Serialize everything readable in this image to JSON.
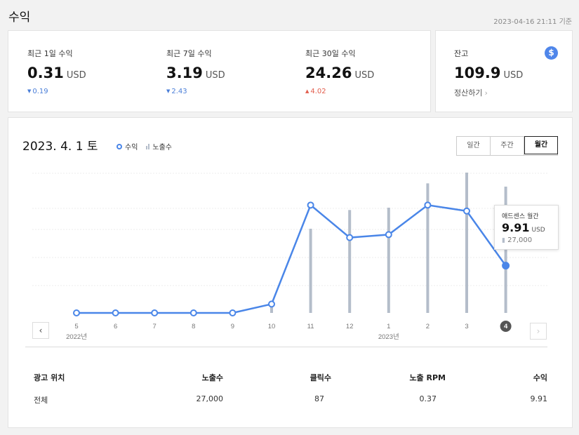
{
  "page": {
    "title": "수익",
    "updated": "2023-04-16 21:11 기준"
  },
  "summary": [
    {
      "label": "최근 1일 수익",
      "value": "0.31",
      "unit": "USD",
      "delta": "0.19",
      "direction": "down"
    },
    {
      "label": "최근 7일 수익",
      "value": "3.19",
      "unit": "USD",
      "delta": "2.43",
      "direction": "down"
    },
    {
      "label": "최근 30일 수익",
      "value": "24.26",
      "unit": "USD",
      "delta": "4.02",
      "direction": "up"
    }
  ],
  "balance": {
    "label": "잔고",
    "value": "109.9",
    "unit": "USD",
    "icon": "$",
    "settle_label": "정산하기",
    "settle_chevron": "›"
  },
  "chart_header": {
    "date": "2023. 4. 1 토",
    "legend_revenue": "수익",
    "legend_impressions": "노출수",
    "tabs": [
      "일간",
      "주간",
      "월간"
    ],
    "active_tab": "월간",
    "prev_icon": "‹",
    "next_icon": "›"
  },
  "chart_data": {
    "type": "line",
    "categories": [
      "5",
      "6",
      "7",
      "8",
      "9",
      "10",
      "11",
      "12",
      "1",
      "2",
      "3",
      "4"
    ],
    "year_labels": [
      {
        "at": "5",
        "text": "2022년"
      },
      {
        "at": "1",
        "text": "2023년"
      }
    ],
    "series": [
      {
        "name": "수익",
        "type": "line",
        "values": [
          0,
          0,
          0,
          0,
          0,
          0.6,
          7.3,
          5.1,
          5.3,
          7.3,
          6.9,
          3.2
        ]
      },
      {
        "name": "노출수",
        "type": "bar",
        "values": [
          0,
          0,
          0,
          0,
          0,
          1300,
          18000,
          22000,
          22500,
          27700,
          30000,
          27000
        ]
      }
    ],
    "ylim": [
      -0.8,
      9.5
    ],
    "bar_ylim": [
      0,
      33000
    ],
    "highlight_index": 11,
    "colors": {
      "line": "#4a86e8",
      "bar": "#b4bdca",
      "grid": "#ececec"
    }
  },
  "tooltip": {
    "title": "애드센스 월간",
    "value": "9.91",
    "unit": "USD",
    "impressions": "27,000"
  },
  "table": {
    "headers": [
      "광고 위치",
      "노출수",
      "클릭수",
      "노출 RPM",
      "수익"
    ],
    "rows": [
      [
        "전체",
        "27,000",
        "87",
        "0.37",
        "9.91"
      ]
    ]
  }
}
